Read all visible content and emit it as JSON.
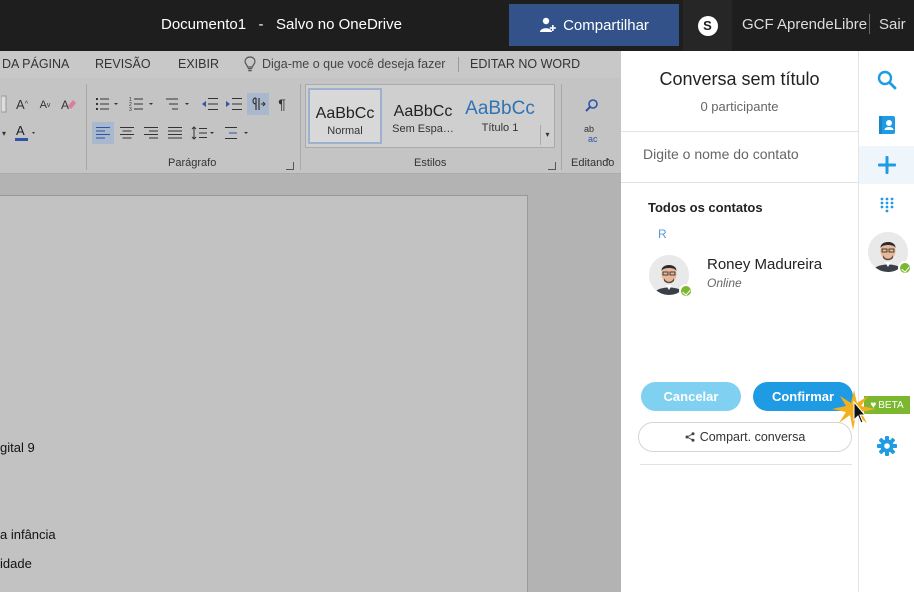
{
  "titlebar": {
    "doc_title": "Documento1   -   Salvo no OneDrive",
    "share_label": "Compartilhar",
    "user_name": "GCF AprendeLibre",
    "signout_label": "Sair"
  },
  "ribbon": {
    "tabs": [
      "DA PÁGINA",
      "REVISÃO",
      "EXIBIR",
      "EDITAR NO WORD"
    ],
    "tell_me": "Diga-me o que você deseja fazer",
    "groups": {
      "paragraph": "Parágrafo",
      "styles": "Estilos",
      "editing": "Editando"
    },
    "styles": [
      {
        "sample": "AaBbCc",
        "name": "Normal"
      },
      {
        "sample": "AaBbCc",
        "name": "Sem Espa…"
      },
      {
        "sample": "AaBbCc",
        "name": "Título 1"
      }
    ]
  },
  "document": {
    "lines": [
      "gital 9",
      "a infância",
      " idade"
    ]
  },
  "panel": {
    "title": "Conversa sem título",
    "participants": "0 participante",
    "search_placeholder": "Digite o nome do contato",
    "contacts_heading": "Todos os contatos",
    "letter": "R",
    "contact": {
      "name": "Roney Madureira",
      "status": "Online"
    },
    "cancel_label": "Cancelar",
    "confirm_label": "Confirmar",
    "share_conv_label": "Compart. conversa"
  },
  "rail": {
    "icons": [
      "search-icon",
      "contacts-book-icon",
      "add-icon",
      "dialpad-icon",
      "profile-avatar",
      "settings-icon"
    ],
    "beta_label": "BETA"
  },
  "colors": {
    "titlebar_bg": "#1e1e1e",
    "share_bg": "#33528a",
    "skype_blue": "#1f9be3",
    "online_green": "#7cb82f"
  }
}
